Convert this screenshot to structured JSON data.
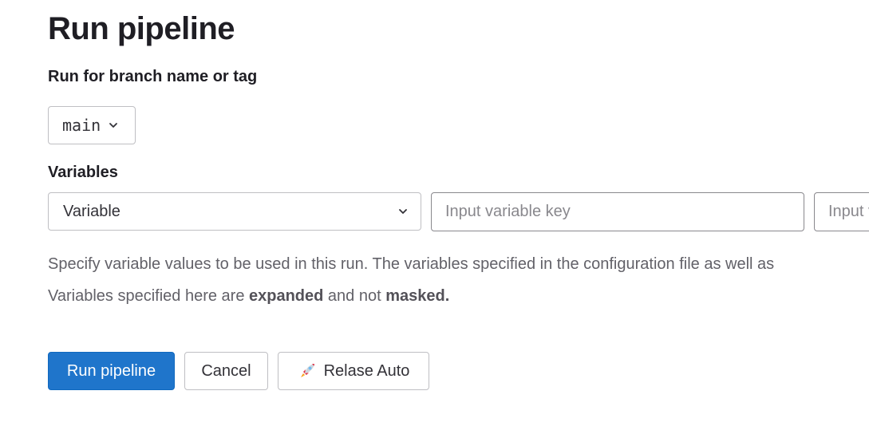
{
  "page": {
    "title": "Run pipeline"
  },
  "branch": {
    "label": "Run for branch name or tag",
    "selected": "main"
  },
  "variables": {
    "label": "Variables",
    "type_selected": "Variable",
    "key_placeholder": "Input variable key",
    "value_placeholder": "Input variable value",
    "help_line1": "Specify variable values to be used in this run. The variables specified in the configuration file as well as",
    "help_line2_prefix": "Variables specified here are ",
    "help_line2_expanded": "expanded",
    "help_line2_middle": " and not ",
    "help_line2_masked": "masked."
  },
  "actions": {
    "run_label": "Run pipeline",
    "cancel_label": "Cancel",
    "release_label": "Relase Auto",
    "release_icon": "rocket-icon"
  },
  "colors": {
    "primary": "#1f75cb",
    "text": "#1f1e24",
    "muted": "#626168",
    "border": "#bfbfc3"
  }
}
